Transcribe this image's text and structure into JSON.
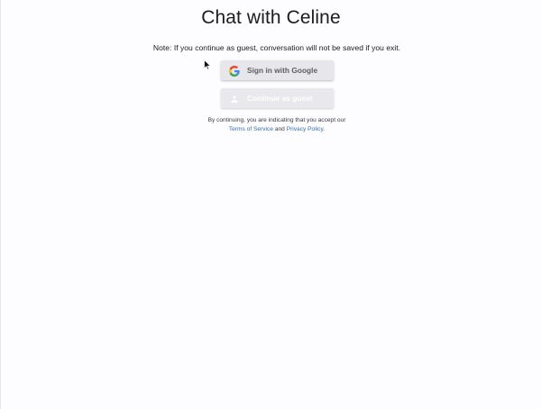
{
  "page": {
    "title": "Chat with Celine",
    "note": "Note: If you continue as guest, conversation will not be saved if you exit."
  },
  "buttons": {
    "google": {
      "label": "Sign in with Google",
      "icon": "google-icon"
    },
    "guest": {
      "label": "Continue as guest",
      "icon": "person-icon"
    }
  },
  "consent": {
    "prefix": "By continuing, you are indicating that you accept our",
    "terms_link": "Terms of Service",
    "conjunction": "and",
    "privacy_link": "Privacy Policy",
    "suffix": "."
  },
  "colors": {
    "background": "#fdfcfe",
    "button": "#e7e6eb",
    "link": "#2f6fb8",
    "text": "#1c1b1f"
  }
}
